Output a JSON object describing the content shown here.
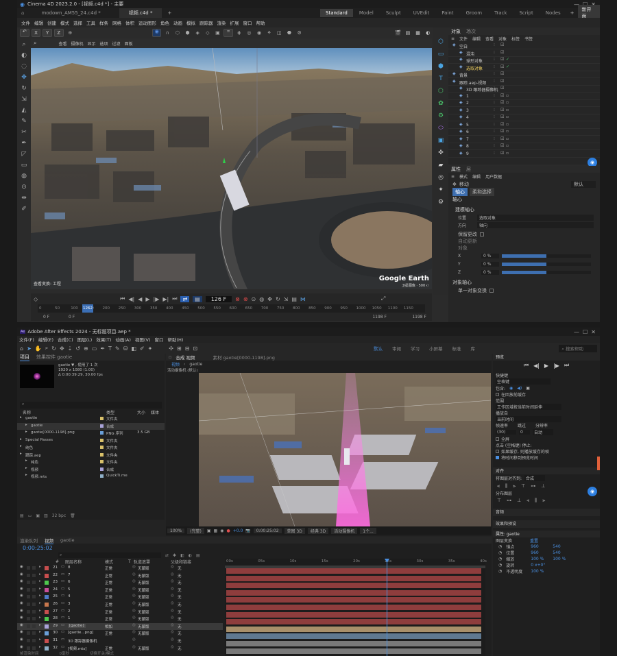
{
  "c4d": {
    "title": "Cinema 4D 2023.2.0 - [视频.c4d *] - 主要",
    "doc_tabs": [
      "modown_AM55_24.c4d *",
      "视频.c4d *"
    ],
    "layouts": [
      "Standard",
      "Model",
      "Sculpt",
      "UVEdit",
      "Paint",
      "Groom",
      "Track",
      "Script",
      "Nodes"
    ],
    "new_layout": "新界面",
    "menu": [
      "文件",
      "编辑",
      "创建",
      "模式",
      "选择",
      "工具",
      "样条",
      "网格",
      "体积",
      "运动图形",
      "角色",
      "动画",
      "模拟",
      "跟踪器",
      "渲染",
      "扩展",
      "窗口",
      "帮助"
    ],
    "axis_labels": [
      "X",
      "Y",
      "Z"
    ],
    "viewport_menu": [
      "查看",
      "摄像机",
      "显示",
      "选项",
      "过滤",
      "面板"
    ],
    "viewport_info": "查看变换: 工程",
    "watermark": "Google Earth",
    "watermark_sub": "卫星图像 · 500 ℮",
    "timeline": {
      "frame_current": "126 F",
      "ticks": [
        "0",
        "50",
        "100",
        "150",
        "200",
        "250",
        "300",
        "350",
        "400",
        "450",
        "500",
        "550",
        "600",
        "650",
        "700",
        "750",
        "800",
        "850",
        "900",
        "950",
        "1000",
        "1050",
        "1100",
        "1150"
      ],
      "start": "0 F",
      "start2": "0 F",
      "end": "1198 F",
      "end2": "1198 F",
      "playhead_label": "1262"
    },
    "object_manager": {
      "tabs": [
        "对象",
        "场次"
      ],
      "menu": [
        "文件",
        "编辑",
        "查看",
        "对象",
        "标签",
        "书签"
      ],
      "items": [
        {
          "name": "空白",
          "indent": 0,
          "sel": false
        },
        {
          "name": "混沌",
          "indent": 1,
          "sel": false
        },
        {
          "name": "球形对象",
          "indent": 1,
          "sel": false
        },
        {
          "name": "选取对象",
          "indent": 1,
          "sel": true
        },
        {
          "name": "背景",
          "indent": 0,
          "sel": false
        },
        {
          "name": "跟踪.aep-视频",
          "indent": 0,
          "sel": false
        },
        {
          "name": "3D 跟踪器摄像机",
          "indent": 1,
          "sel": false
        },
        {
          "name": "1",
          "indent": 1,
          "sel": false
        },
        {
          "name": "2",
          "indent": 1,
          "sel": false
        },
        {
          "name": "3",
          "indent": 1,
          "sel": false
        },
        {
          "name": "4",
          "indent": 1,
          "sel": false
        },
        {
          "name": "5",
          "indent": 1,
          "sel": false
        },
        {
          "name": "6",
          "indent": 1,
          "sel": false
        },
        {
          "name": "7",
          "indent": 1,
          "sel": false
        },
        {
          "name": "8",
          "indent": 1,
          "sel": false
        },
        {
          "name": "9",
          "indent": 1,
          "sel": false
        }
      ]
    },
    "attributes": {
      "tabs": [
        "属性",
        "层"
      ],
      "menu": [
        "模式",
        "编辑",
        "用户数据"
      ],
      "mode": "移动",
      "preset": "默认",
      "buttons": [
        "轴心",
        "柔和选择"
      ],
      "section": "轴心",
      "subsection": "建模轴心",
      "rows": [
        {
          "label": "位置",
          "value": "选取对象"
        },
        {
          "label": "方向",
          "value": "轴向"
        }
      ],
      "keep_changes": "保留更改",
      "auto_update": "自动更新",
      "object_label": "对象",
      "xyz": [
        {
          "axis": "X",
          "value": "0 %",
          "level": 0.5
        },
        {
          "axis": "Y",
          "value": "0 %",
          "level": 0.5
        },
        {
          "axis": "Z",
          "value": "0 %",
          "level": 0.5
        }
      ],
      "object_axis": "对象轴心",
      "single_object": "单一对象变换"
    }
  },
  "ae": {
    "title": "Adobe After Effects 2024 - 无标题项目.aep *",
    "menu": [
      "文件(F)",
      "编辑(E)",
      "合成(C)",
      "图层(L)",
      "效果(T)",
      "动画(A)",
      "视图(V)",
      "窗口",
      "帮助(H)"
    ],
    "workspaces": [
      "默认",
      "审阅",
      "学习",
      "小屏幕",
      "标准",
      "库"
    ],
    "search_help": "搜索帮助",
    "project": {
      "tabs": [
        "项目",
        "效果控件 gaotie"
      ],
      "item_name": "gaotie ▼ , 使用了 1 次",
      "item_info1": "1920 x 1080 (1.00)",
      "item_info2": "Δ 0:00:39:29, 30.00 fps",
      "columns": [
        "名称",
        "类型",
        "大小",
        "媒体"
      ],
      "rows": [
        {
          "name": "gaotie",
          "type": "文件夹",
          "size": "",
          "color": "#d8c06a",
          "indent": 0
        },
        {
          "name": "gaotie",
          "type": "合成",
          "size": "",
          "color": "#a9a3d9",
          "indent": 1,
          "sel": true
        },
        {
          "name": "gaotie[0000-1198].png",
          "type": "PNG 序列",
          "size": "3.5 GB",
          "color": "#6a9fd8",
          "indent": 1
        },
        {
          "name": "Special Passes",
          "type": "文件夹",
          "size": "",
          "color": "#d8c06a",
          "indent": 0
        },
        {
          "name": "纯色",
          "type": "文件夹",
          "size": "",
          "color": "#d8c06a",
          "indent": 0
        },
        {
          "name": "跟踪.aep",
          "type": "文件夹",
          "size": "",
          "color": "#d8c06a",
          "indent": 0
        },
        {
          "name": "纯色",
          "type": "文件夹",
          "size": "",
          "color": "#d8c06a",
          "indent": 1
        },
        {
          "name": "视频",
          "type": "合成",
          "size": "",
          "color": "#a9a3d9",
          "indent": 1
        },
        {
          "name": "视频.mts",
          "type": "QuickTi.me",
          "size": "",
          "color": "#8fb0c8",
          "indent": 1
        }
      ],
      "bpc": "32 bpc"
    },
    "comp": {
      "tabs": [
        "合成 视频",
        "素材 gaotie[0000-1198].png"
      ],
      "sub_tabs": [
        "视频",
        "gaotie"
      ],
      "extra_tabs": [
        "通用",
        "对齐"
      ],
      "label": "活动摄像机 (默认)",
      "zoom": "100%",
      "quality": "(完整)",
      "timecode": "0:00:25:02",
      "view": "草图 3D",
      "renderer": "经典 3D",
      "camera": "活动摄像机",
      "views": "1个..."
    },
    "right_panel": {
      "preview_title": "预览",
      "shortcut_label": "快捷键",
      "shortcut": "空格键",
      "include": "包含:",
      "cache": "在回放前缓存",
      "range_label": "范围",
      "range": "工作区域按当前时间延伸",
      "play_from_label": "播放自",
      "play_from": "当前时间",
      "fps_label": "帧速率",
      "skip_label": "跳过",
      "res_label": "分辨率",
      "fps": "(30)",
      "skip": "0",
      "res": "自动",
      "fullscreen": "全屏",
      "on_stop": "点击 (空格键) 停止:",
      "cache_opt": "如果缓存, 则播放缓存的帧",
      "move_time": "将时间移到预览时间",
      "align_title": "对齐",
      "align_to_label": "将图层对齐到:",
      "align_to": "合成",
      "distribute": "分布图层",
      "sections": [
        "音频",
        "效果和预设"
      ],
      "props_title": "属性: gaotie",
      "layer_transform": "图层变换",
      "reset": "重置",
      "transform": [
        {
          "label": "锚点",
          "v1": "960",
          "v2": "540"
        },
        {
          "label": "位置",
          "v1": "960",
          "v2": "540"
        },
        {
          "label": "缩放",
          "v1": "100 %",
          "v2": "100 %"
        },
        {
          "label": "旋转",
          "v1": "0 x+0°",
          "v2": ""
        },
        {
          "label": "不透明度",
          "v1": "100 %",
          "v2": ""
        }
      ]
    },
    "timeline": {
      "tabs": [
        "渲染队列",
        "视频",
        "gaotie"
      ],
      "timecode": "0:00:25:02",
      "columns": [
        "#",
        "图层名称",
        "模式",
        "T",
        "轨道遮罩",
        "父级和链接"
      ],
      "ruler": [
        "00s",
        "05s",
        "10s",
        "15s",
        "20s",
        "25s",
        "30s",
        "35s",
        "40s"
      ],
      "layers": [
        {
          "num": "21",
          "name": "8",
          "mode": "正常",
          "matte": "无蒙版",
          "parent": "无",
          "color": "#c84e4e"
        },
        {
          "num": "22",
          "name": "7",
          "mode": "正常",
          "matte": "无蒙版",
          "parent": "无",
          "color": "#c84e4e"
        },
        {
          "num": "23",
          "name": "6",
          "mode": "正常",
          "matte": "无蒙版",
          "parent": "无",
          "color": "#4ec84e"
        },
        {
          "num": "24",
          "name": "5",
          "mode": "正常",
          "matte": "无蒙版",
          "parent": "无",
          "color": "#c84e9a"
        },
        {
          "num": "25",
          "name": "4",
          "mode": "正常",
          "matte": "无蒙版",
          "parent": "无",
          "color": "#4e7ac8"
        },
        {
          "num": "26",
          "name": "3",
          "mode": "正常",
          "matte": "无蒙版",
          "parent": "无",
          "color": "#c8784e"
        },
        {
          "num": "27",
          "name": "2",
          "mode": "正常",
          "matte": "无蒙版",
          "parent": "无",
          "color": "#c84e4e"
        },
        {
          "num": "28",
          "name": "1",
          "mode": "正常",
          "matte": "无蒙版",
          "parent": "无",
          "color": "#4ec84e"
        },
        {
          "num": "29",
          "name": "[gaotie]",
          "mode": "相加",
          "matte": "无蒙版",
          "parent": "无",
          "color": "#a9a3d9",
          "sel": true
        },
        {
          "num": "30",
          "name": "[gaotie...png]",
          "mode": "正常",
          "matte": "无蒙版",
          "parent": "无",
          "color": "#6a9fd8"
        },
        {
          "num": "31",
          "name": "3D 跟踪器摄像机",
          "mode": "",
          "matte": "",
          "parent": "无",
          "color": "#c84e4e"
        },
        {
          "num": "32",
          "name": "[视频.mts]",
          "mode": "正常",
          "matte": "无蒙版",
          "parent": "无",
          "color": "#8fb0c8"
        }
      ],
      "footer": [
        "帧渲染时间",
        "切换开关/模式"
      ],
      "footer_time": "0毫秒"
    }
  }
}
